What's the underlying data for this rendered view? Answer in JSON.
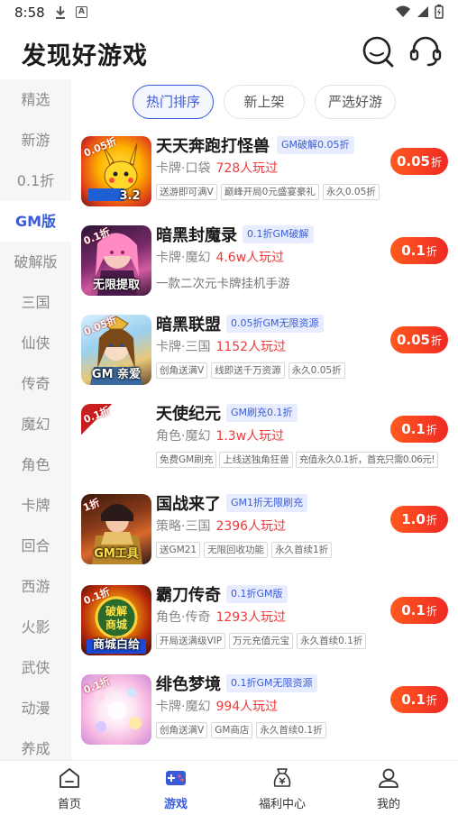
{
  "status": {
    "time": "8:58"
  },
  "header": {
    "title": "发现好游戏"
  },
  "sidebar": {
    "items": [
      {
        "label": "精选"
      },
      {
        "label": "新游"
      },
      {
        "label": "0.1折"
      },
      {
        "label": "GM版"
      },
      {
        "label": "破解版"
      },
      {
        "label": "三国"
      },
      {
        "label": "仙侠"
      },
      {
        "label": "传奇"
      },
      {
        "label": "魔幻"
      },
      {
        "label": "角色"
      },
      {
        "label": "卡牌"
      },
      {
        "label": "回合"
      },
      {
        "label": "西游"
      },
      {
        "label": "火影"
      },
      {
        "label": "武侠"
      },
      {
        "label": "动漫"
      },
      {
        "label": "养成"
      }
    ],
    "active_index": 3
  },
  "tabs": [
    {
      "label": "热门排序"
    },
    {
      "label": "新上架"
    },
    {
      "label": "严选好游"
    }
  ],
  "games": [
    {
      "name": "天天奔跑打怪兽",
      "badge": "GM破解0.05折",
      "meta": "卡牌·口袋",
      "players": "728人玩过",
      "tags": [
        "送游即可满V",
        "巅峰开局0元盛宴豪礼",
        "永久0.05折"
      ],
      "discount": "0.05",
      "unit": "折",
      "thumb_tag": "0.05折",
      "thumb_caption": "3.2"
    },
    {
      "name": "暗黑封魔录",
      "badge": "0.1折GM破解",
      "meta": "卡牌·魔幻",
      "players": "4.6w人玩过",
      "desc": "一款二次元卡牌挂机手游",
      "discount": "0.1",
      "unit": "折",
      "thumb_tag": "0.1折",
      "thumb_caption": "无限提取"
    },
    {
      "name": "暗黑联盟",
      "badge": "0.05折GM无限资源",
      "meta": "卡牌·三国",
      "players": "1152人玩过",
      "tags": [
        "创角送满V",
        "线即送千万资源",
        "永久0.05折"
      ],
      "discount": "0.05",
      "unit": "折",
      "thumb_tag": "0.05折",
      "thumb_caption": "GM 亲爱"
    },
    {
      "name": "天使纪元",
      "badge": "GM刷充0.1折",
      "meta": "角色·魔幻",
      "players": "1.3w人玩过",
      "tags": [
        "免费GM刷充",
        "上线送独角狂兽",
        "充值永久0.1折，首充只需0.06元!"
      ],
      "discount": "0.1",
      "unit": "折",
      "thumb_tag": "0.1折",
      "thumb_caption": ""
    },
    {
      "name": "国战来了",
      "badge": "GM1折无限刷充",
      "meta": "策略·三国",
      "players": "2396人玩过",
      "tags": [
        "送GM21",
        "无限回收功能",
        "永久首续1折"
      ],
      "discount": "1.0",
      "unit": "折",
      "thumb_tag": "1折",
      "thumb_caption": "GM工具"
    },
    {
      "name": "霸刀传奇",
      "badge": "0.1折GM版",
      "meta": "角色·传奇",
      "players": "1293人玩过",
      "tags": [
        "开局送满级VIP",
        "万元充值元宝",
        "永久首续0.1折"
      ],
      "discount": "0.1",
      "unit": "折",
      "thumb_tag": "0.1折",
      "thumb_caption": "商城白给"
    },
    {
      "name": "绯色梦境",
      "badge": "0.1折GM无限资源",
      "meta": "卡牌·魔幻",
      "players": "994人玩过",
      "tags": [
        "创角送满V",
        "GM商店",
        "永久首续0.1折"
      ],
      "discount": "0.1",
      "unit": "折",
      "thumb_tag": "0.1折",
      "thumb_caption": ""
    }
  ],
  "bottom_nav": [
    {
      "label": "首页",
      "icon": "home-icon"
    },
    {
      "label": "游戏",
      "icon": "gamepad-icon"
    },
    {
      "label": "福利中心",
      "icon": "welfare-icon"
    },
    {
      "label": "我的",
      "icon": "profile-icon"
    }
  ],
  "colors": {
    "accent": "#3a5bd9",
    "price_red": "#ec3b3b",
    "button_orange": "#ff5a1f"
  }
}
